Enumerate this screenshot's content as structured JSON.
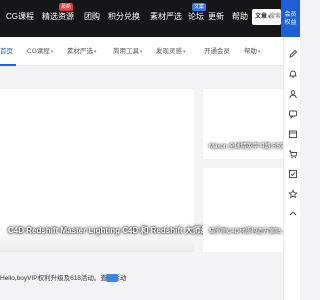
{
  "topnav": {
    "items": [
      "CG课程",
      "精选资源",
      "团购",
      "积分兑换",
      "素材严选",
      "论坛",
      "更新",
      "帮助"
    ],
    "badges": [
      "最新",
      "文案"
    ],
    "badge_colors": [
      "#e23a3a",
      "#2f7ce8"
    ]
  },
  "search": {
    "selector": "文章",
    "arrow": "▾",
    "placeholder": "搜索"
  },
  "login": {
    "line1": "会员",
    "line2": "权益"
  },
  "subnav": {
    "items": [
      "首页",
      "CG课程",
      "素材严选",
      "简用工具",
      "发现灵感",
      "开通会员",
      "帮助"
    ],
    "caret": "▾"
  },
  "cards": {
    "main_title": "C4D Redshift Master Lighting C4D 和 Redshift 大师级灯光...",
    "side1_title": "Maxon 全球精英学习路 R5渲染...",
    "side2_title": "瞄罗丽C4D材质构造方案贴..."
  },
  "notice": {
    "text": "Hello,boyVIP权利升级及618活动。查看活动"
  },
  "sidebar": {
    "icons": [
      "edit-icon",
      "bell-icon",
      "user-icon",
      "comment-icon",
      "calendar-icon",
      "cart-icon",
      "checklist-icon",
      "star-icon",
      "back-to-top-icon"
    ]
  },
  "colors": {
    "accent": "#1d5fd4",
    "topbar": "#161618",
    "badge_red": "#e23a3a",
    "badge_blue": "#2f7ce8"
  }
}
